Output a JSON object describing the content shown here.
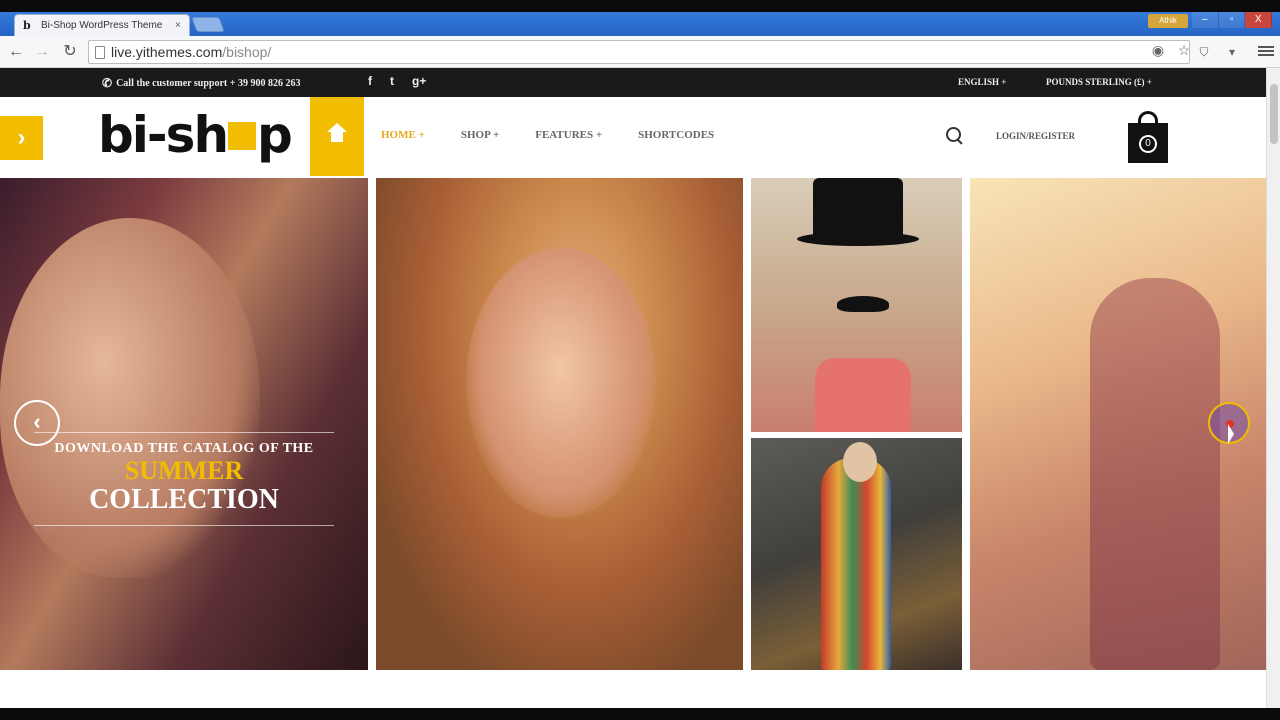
{
  "browser": {
    "tab_title": "Bi-Shop WordPress Theme",
    "tab_favicon": "b",
    "tab_close": "×",
    "user_badge": "Athik",
    "window_minimize": "–",
    "window_restore": "▫",
    "window_close": "X",
    "url_host": "live.yithemes.com",
    "url_path": "/bishop/"
  },
  "topbar": {
    "support_text": "Call the customer support + 39 900 826 263",
    "socials": [
      "f",
      "t",
      "g+"
    ],
    "language": "ENGLISH +",
    "currency": "POUNDS STERLING (£) +"
  },
  "header": {
    "logo_left": "bi-sh",
    "logo_right": "p",
    "nav": [
      {
        "label": "HOME +"
      },
      {
        "label": "SHOP +"
      },
      {
        "label": "FEATURES +"
      },
      {
        "label": "SHORTCODES"
      }
    ],
    "login": "LOGIN/REGISTER",
    "cart_count": "0"
  },
  "banner": {
    "line1": "DOWNLOAD THE CATALOG OF THE",
    "line2": "SUMMER",
    "line3": "COLLECTION"
  },
  "colors": {
    "accent": "#f2bc00",
    "topbar_bg": "#1a1a1a",
    "nav_active": "#e6a91d"
  },
  "icons": {
    "back": "back-arrow-icon",
    "forward": "forward-arrow-icon",
    "reload": "reload-icon",
    "home": "home-icon",
    "search": "search-icon",
    "cart": "shopping-bag-icon",
    "phone": "phone-icon"
  }
}
